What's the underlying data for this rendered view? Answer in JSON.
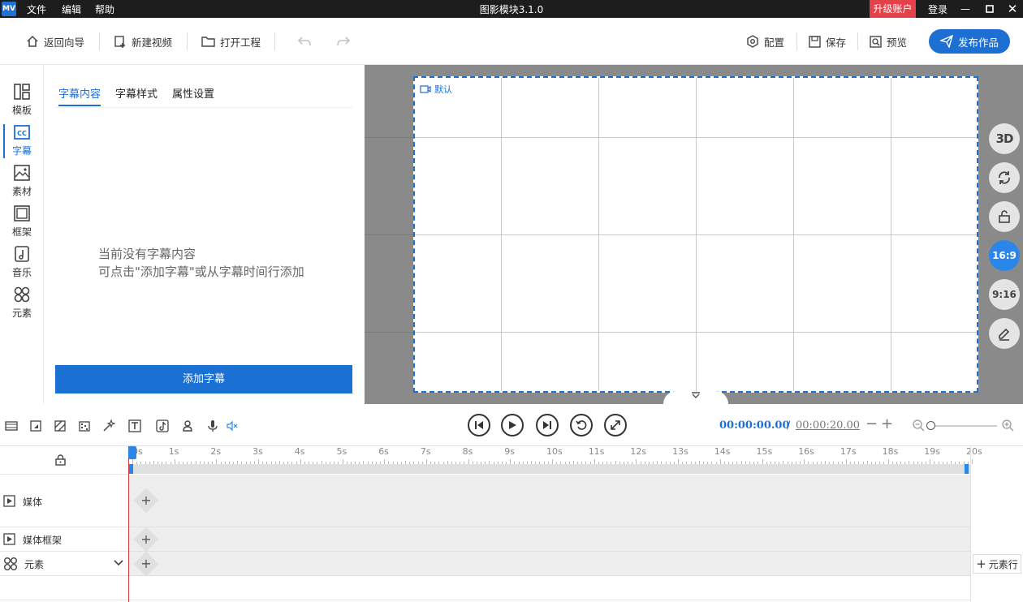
{
  "app": {
    "logo_text": "MV",
    "title": "图影模块3.1.0",
    "menus": [
      "文件",
      "编辑",
      "帮助"
    ],
    "upgrade": "升级账户",
    "login": "登录"
  },
  "toolbar": {
    "back": "返回向导",
    "new_video": "新建视频",
    "open_project": "打开工程",
    "config": "配置",
    "save": "保存",
    "preview": "预览",
    "publish": "发布作品"
  },
  "sidebar": {
    "items": [
      {
        "label": "模板",
        "icon": "template-icon"
      },
      {
        "label": "字幕",
        "icon": "subtitle-cc-icon",
        "active": true
      },
      {
        "label": "素材",
        "icon": "image-icon"
      },
      {
        "label": "框架",
        "icon": "frame-icon"
      },
      {
        "label": "音乐",
        "icon": "music-icon"
      },
      {
        "label": "元素",
        "icon": "elements-icon"
      }
    ]
  },
  "panel": {
    "tabs": [
      "字幕内容",
      "字幕样式",
      "属性设置"
    ],
    "active_tab": 0,
    "empty_line1": "当前没有字幕内容",
    "empty_line2": "可点击\"添加字幕\"或从字幕时间行添加",
    "add_button": "添加字幕"
  },
  "preview": {
    "canvas_label": "默认",
    "right_tools": [
      {
        "label": "3D",
        "icon": "3d-icon"
      },
      {
        "label": "",
        "icon": "rotate-icon"
      },
      {
        "label": "",
        "icon": "unlock-icon"
      },
      {
        "label": "16:9",
        "active": true
      },
      {
        "label": "9:16"
      },
      {
        "label": "",
        "icon": "edit-icon"
      }
    ]
  },
  "controls": {
    "current_time": "00:00:00.00",
    "separator": "/",
    "total_time": "00:00:20.00"
  },
  "timeline": {
    "ruler_labels": [
      "0s",
      "1s",
      "2s",
      "3s",
      "4s",
      "5s",
      "6s",
      "7s",
      "8s",
      "9s",
      "10s",
      "11s",
      "12s",
      "13s",
      "14s",
      "15s",
      "16s",
      "17s",
      "18s",
      "19s",
      "20s"
    ],
    "tracks": [
      {
        "name": "媒体",
        "icon": "play-square-icon"
      },
      {
        "name": "媒体框架",
        "icon": "play-square-icon"
      },
      {
        "name": "元素",
        "icon": "elements-icon"
      }
    ],
    "add_element_row": "元素行"
  }
}
